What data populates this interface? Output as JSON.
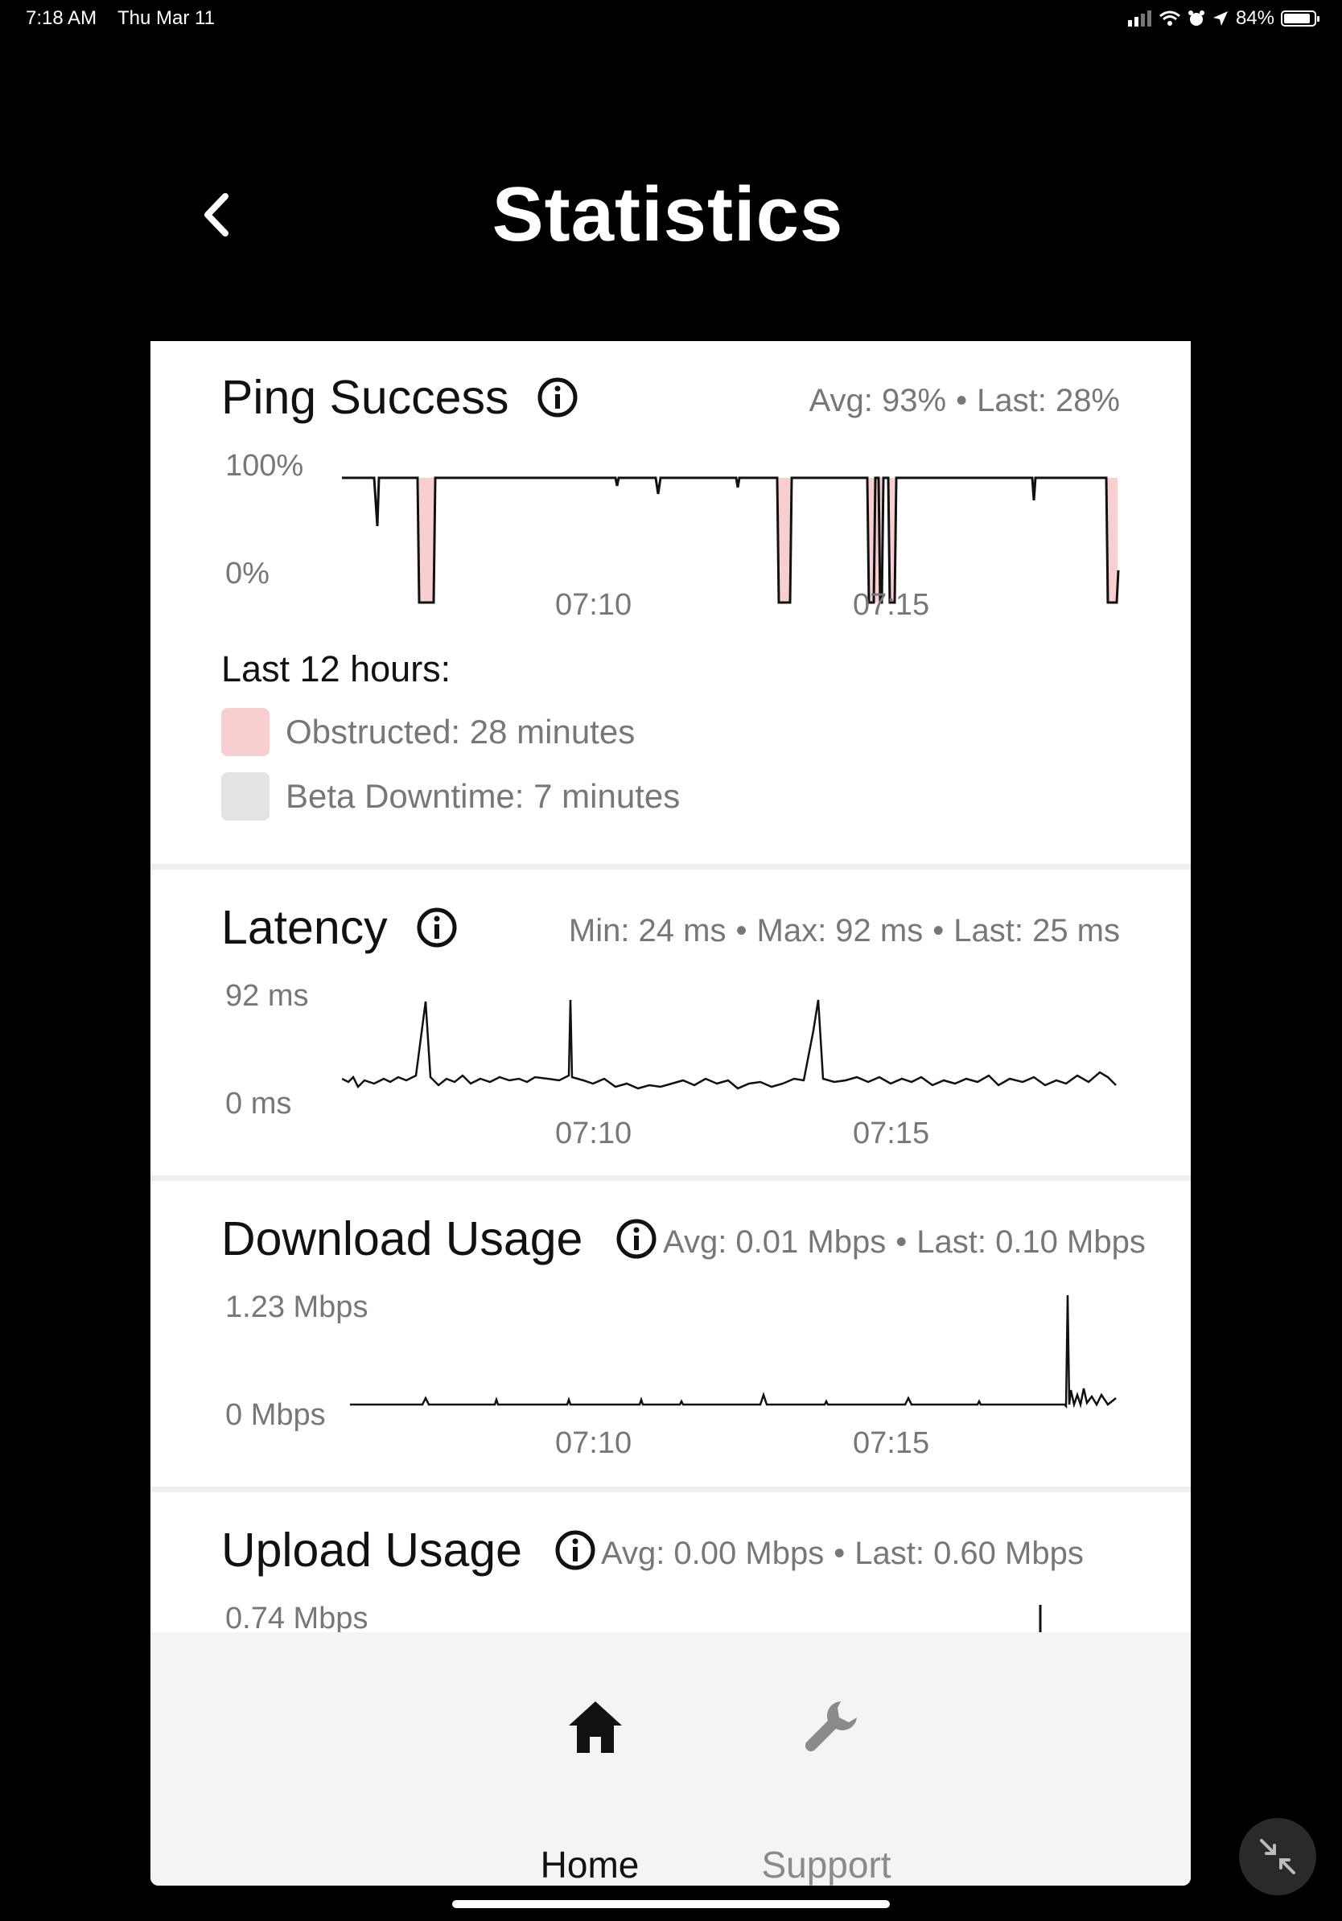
{
  "status_bar": {
    "time": "7:18 AM",
    "date": "Thu Mar 11",
    "battery": "84%"
  },
  "header": {
    "title": "Statistics"
  },
  "ping": {
    "title": "Ping Success",
    "avg": "Avg: 93%",
    "last": "Last: 28%",
    "y_max": "100%",
    "y_min": "0%",
    "x_ticks": [
      "07:10",
      "07:15"
    ],
    "legend_title": "Last 12 hours:",
    "legend": [
      {
        "label": "Obstructed: 28 minutes",
        "color": "#f7cfd0"
      },
      {
        "label": "Beta Downtime: 7 minutes",
        "color": "#e3e3e3"
      }
    ]
  },
  "latency": {
    "title": "Latency",
    "min": "Min: 24 ms",
    "max": "Max: 92 ms",
    "last": "Last: 25 ms",
    "y_max": "92 ms",
    "y_min": "0 ms",
    "x_ticks": [
      "07:10",
      "07:15"
    ]
  },
  "download": {
    "title": "Download Usage",
    "avg": "Avg: 0.01 Mbps",
    "last": "Last: 0.10 Mbps",
    "y_max": "1.23 Mbps",
    "y_min": "0 Mbps",
    "x_ticks": [
      "07:10",
      "07:15"
    ]
  },
  "upload": {
    "title": "Upload Usage",
    "avg": "Avg: 0.00 Mbps",
    "last": "Last: 0.60 Mbps",
    "y_max": "0.74 Mbps"
  },
  "nav": {
    "home": "Home",
    "support": "Support"
  },
  "colors": {
    "obstructed": "#f7cfd0",
    "downtime": "#e3e3e3",
    "active_nav": "#111111",
    "inactive_nav": "#8a8a8a"
  }
}
